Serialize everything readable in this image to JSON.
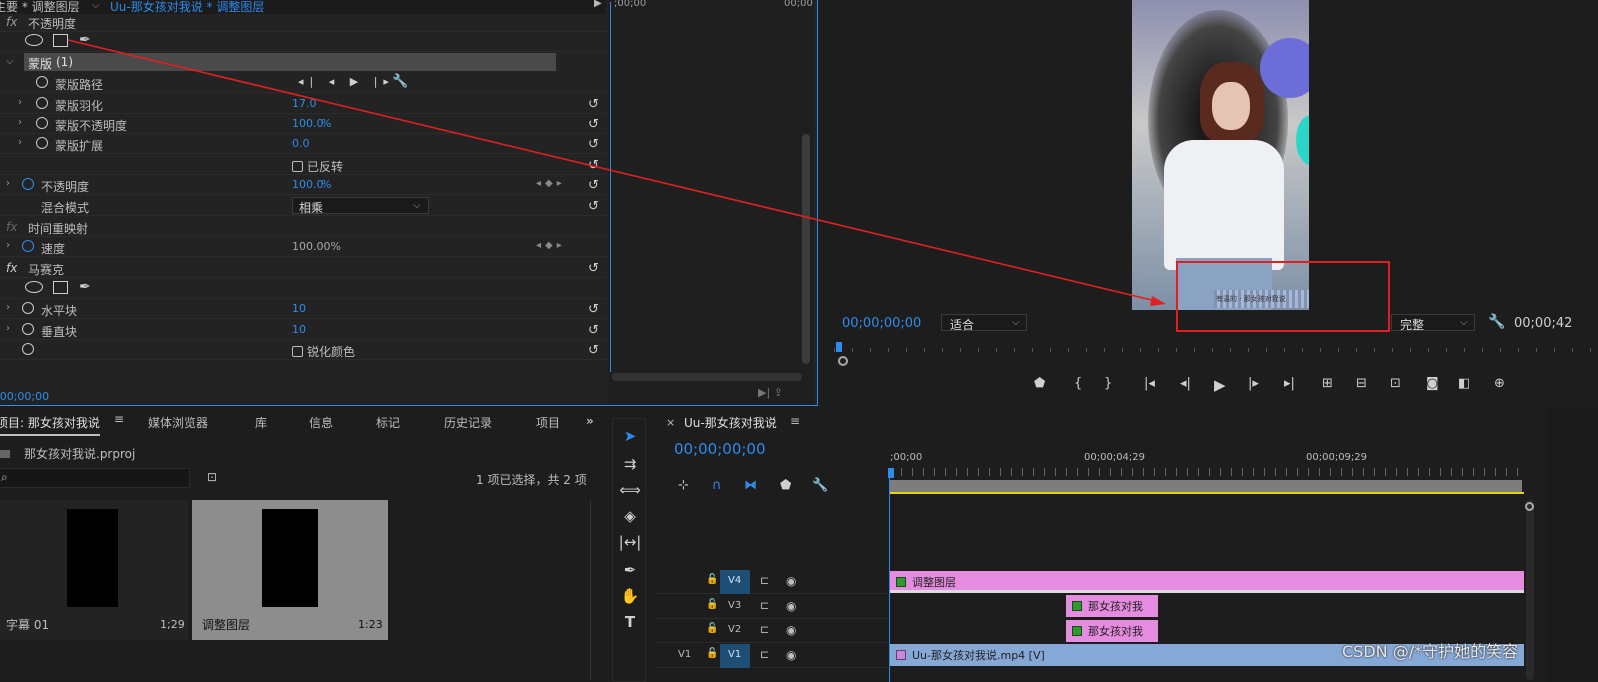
{
  "effect_controls": {
    "header_left": "主要 * 调整图层",
    "header_right": "Uu-那女孩对我说 * 调整图层",
    "ruler_start": ";00;00",
    "ruler_end": "00;00",
    "rows": {
      "opacity_top": "不透明度",
      "mask_name": "蒙版",
      "mask_count": "(1)",
      "mask_path": "蒙版路径",
      "mask_feather": "蒙版羽化",
      "mask_feather_val": "17.0",
      "mask_opacity": "蒙版不透明度",
      "mask_opacity_val": "100.0",
      "mask_opacity_unit": "%",
      "mask_expand": "蒙版扩展",
      "mask_expand_val": "0.0",
      "inverted": "已反转",
      "opacity": "不透明度",
      "opacity_val": "100.0",
      "opacity_unit": "%",
      "blend_mode": "混合模式",
      "blend_val": "相乘",
      "time_remap": "时间重映射",
      "speed": "速度",
      "speed_val": "100.00%",
      "mosaic": "马赛克",
      "h_blocks": "水平块",
      "h_blocks_val": "10",
      "v_blocks": "垂直块",
      "v_blocks_val": "10",
      "sharpen": "锐化颜色"
    },
    "footer_time": ";00;00;00"
  },
  "program_monitor": {
    "timecode_left": "00;00;00;00",
    "fit_label": "适合",
    "quality_label": "完整",
    "timecode_right": "00;00;42",
    "overlay_text": "有温的 · 那女孩对我说"
  },
  "project": {
    "tabs": [
      "项目: 那女孩对我说",
      "媒体浏览器",
      "库",
      "信息",
      "标记",
      "历史记录",
      "项目"
    ],
    "file_name": "那女孩对我说.prproj",
    "selection_info": "1 项已选择，共 2 项",
    "items": [
      {
        "name": "字幕 01",
        "duration": "1;29"
      },
      {
        "name": "调整图层",
        "duration": "1:23"
      }
    ]
  },
  "timeline": {
    "sequence_name": "Uu-那女孩对我说",
    "timecode": "00;00;00;00",
    "ruler_labels": [
      ";00;00",
      "00;00;04;29",
      "00;00;09;29"
    ],
    "tracks": [
      {
        "label": "V4",
        "clip": "调整图层"
      },
      {
        "label": "V3",
        "clip": "那女孩对我"
      },
      {
        "label": "V2",
        "clip": "那女孩对我"
      },
      {
        "label": "V1",
        "source": "V1",
        "clip": "Uu-那女孩对我说.mp4 [V]"
      }
    ]
  },
  "watermark": "CSDN @/*守护她的笑容",
  "colors": {
    "accent": "#2d8ceb",
    "adjustment_clip": "#e58ce0",
    "video_clip": "#86a8d6",
    "arrow": "#e02020"
  }
}
